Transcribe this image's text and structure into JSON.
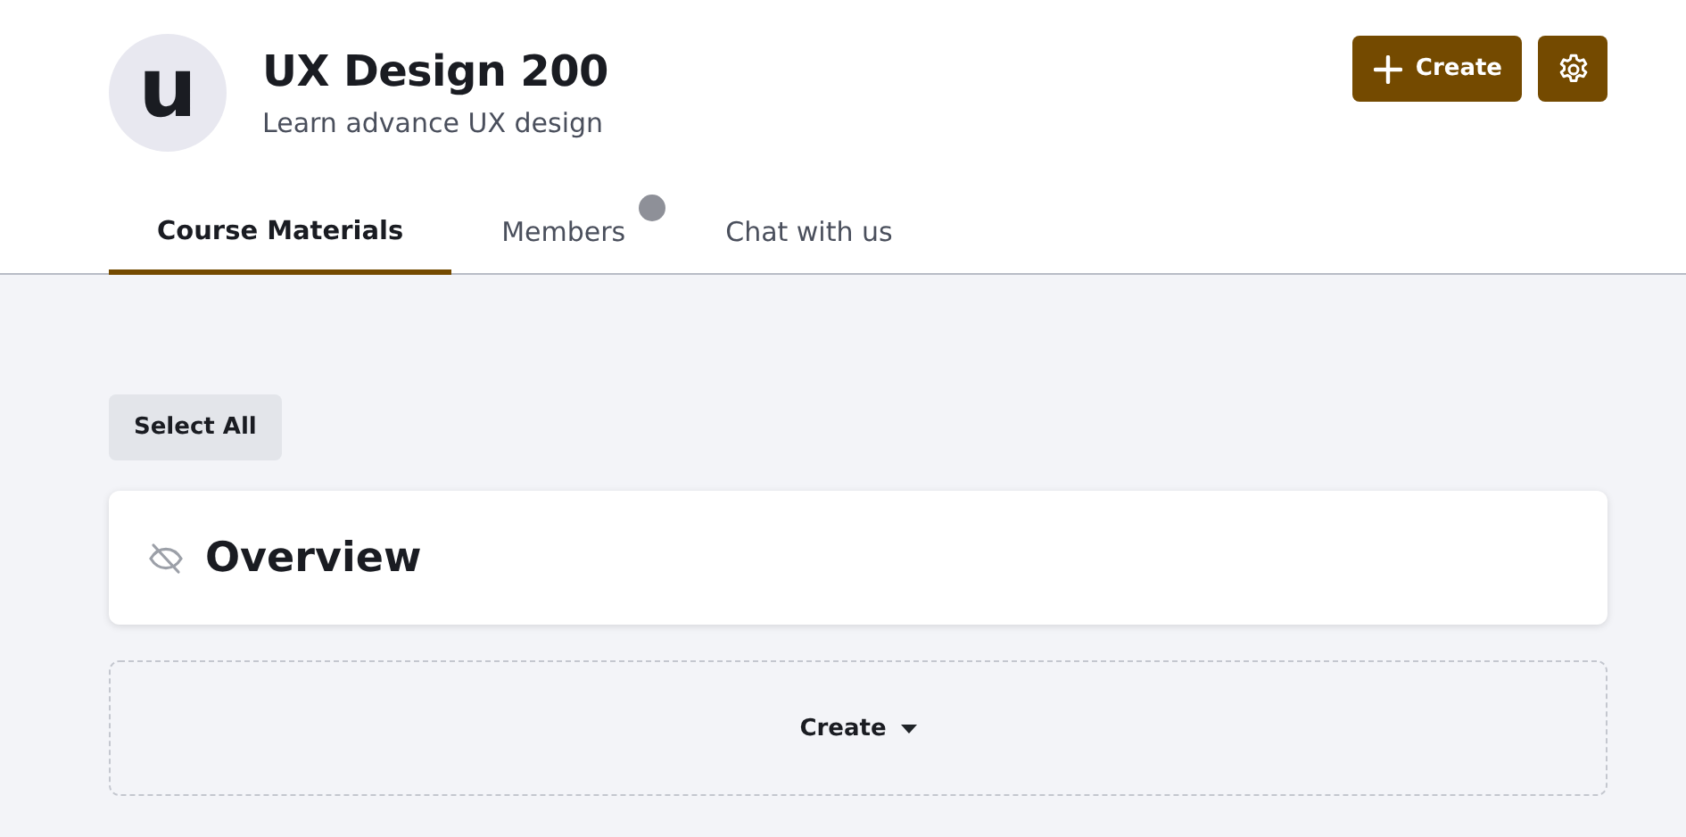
{
  "course": {
    "avatar_letter": "u",
    "title": "UX Design 200",
    "subtitle": "Learn advance UX design"
  },
  "header_buttons": [
    {
      "kind": "create",
      "label": "Create"
    },
    {
      "kind": "settings"
    }
  ],
  "tabs": [
    {
      "label": "Course Materials",
      "selected": true,
      "badge": false
    },
    {
      "label": "Members",
      "selected": false,
      "badge": true
    },
    {
      "label": "Chat with us",
      "selected": false,
      "badge": false
    }
  ],
  "select_all": "Select All",
  "sections": [
    {
      "title": "Overview",
      "hidden": true
    }
  ],
  "create_menu": {
    "label": "Create"
  }
}
